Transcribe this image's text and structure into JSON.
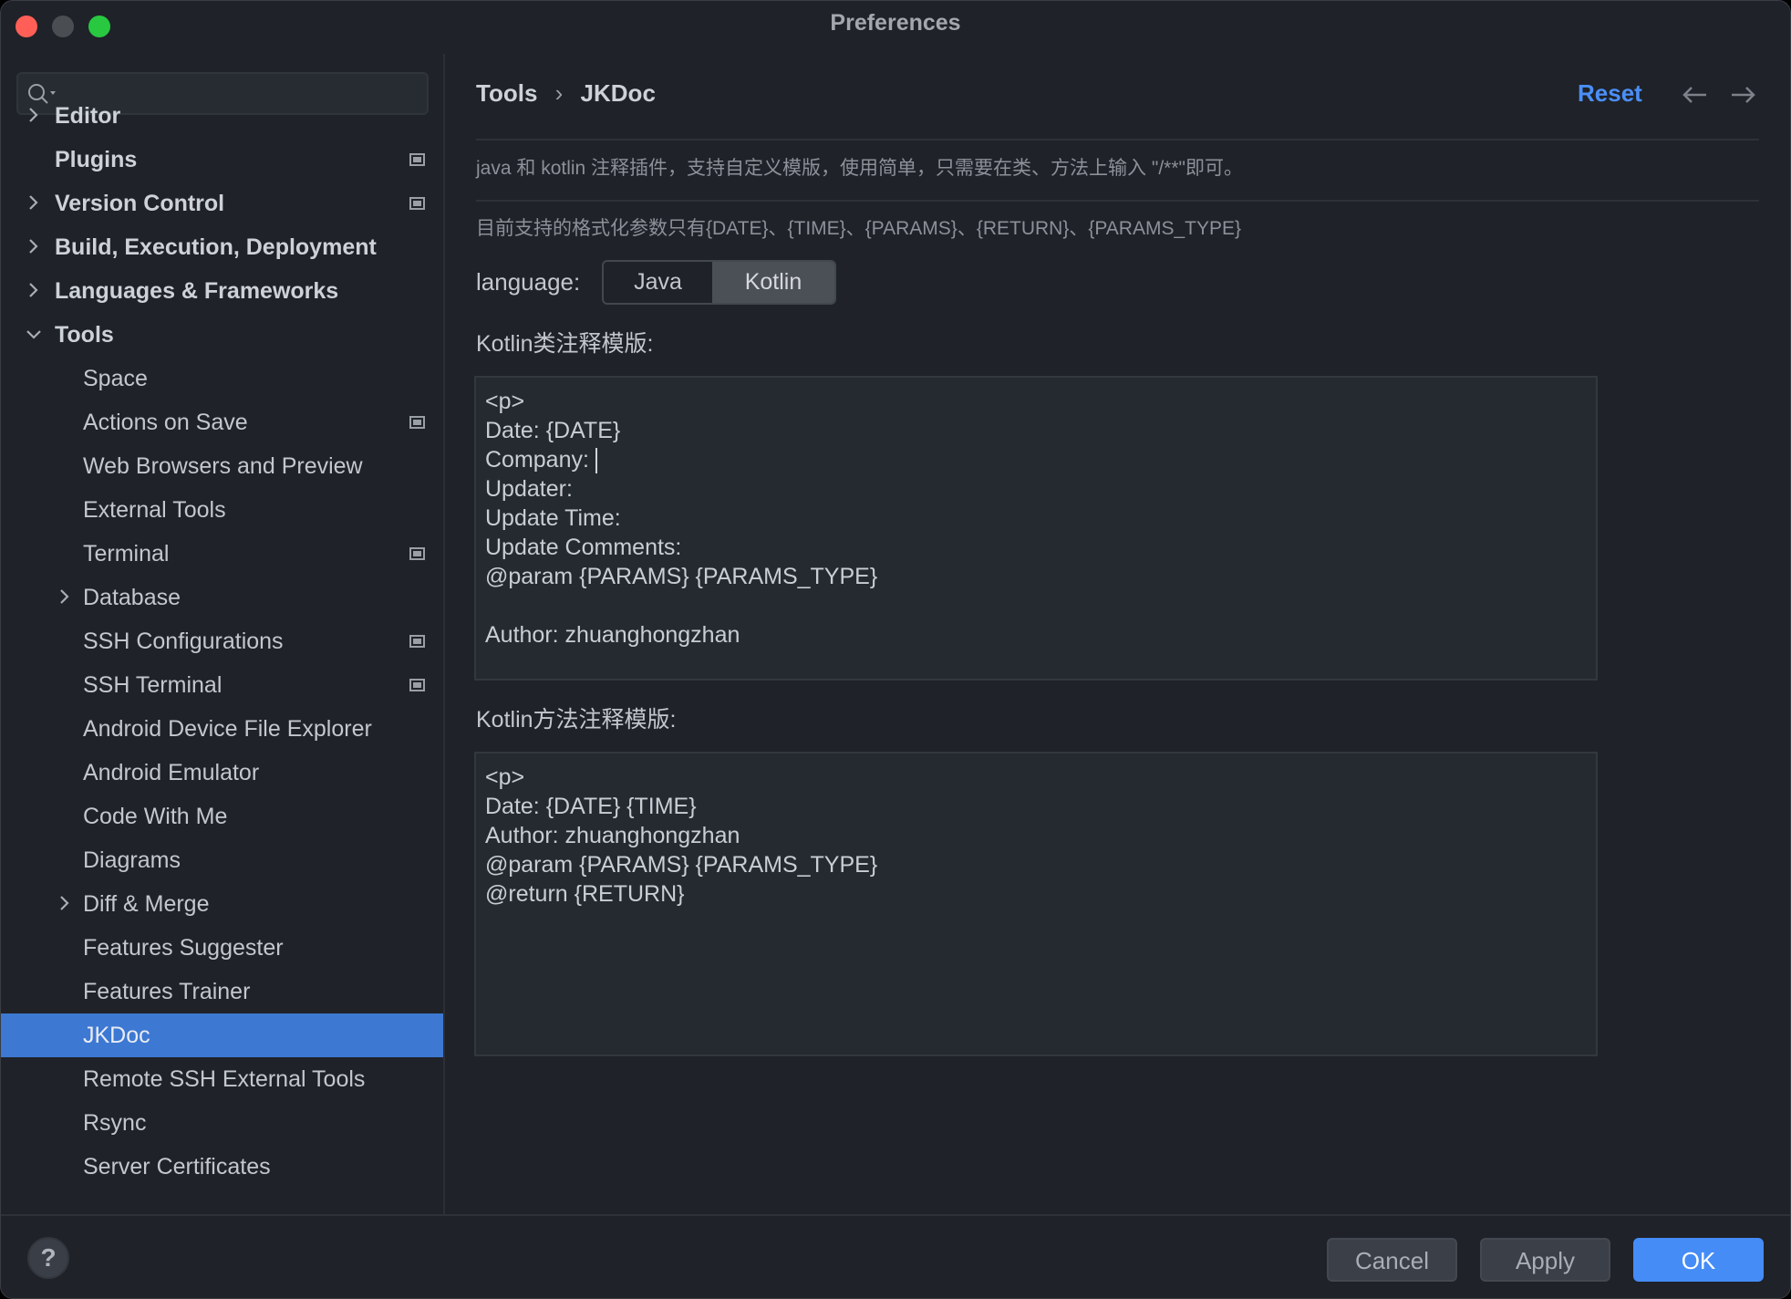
{
  "window": {
    "title": "Preferences"
  },
  "sidebar": {
    "search_placeholder": "",
    "items": [
      {
        "label": "Editor",
        "level": 0,
        "chevron": "right",
        "icon": false
      },
      {
        "label": "Plugins",
        "level": 0,
        "chevron": "",
        "icon": true
      },
      {
        "label": "Version Control",
        "level": 0,
        "chevron": "right",
        "icon": true
      },
      {
        "label": "Build, Execution, Deployment",
        "level": 0,
        "chevron": "right",
        "icon": false
      },
      {
        "label": "Languages & Frameworks",
        "level": 0,
        "chevron": "right",
        "icon": false
      },
      {
        "label": "Tools",
        "level": 0,
        "chevron": "down",
        "icon": false
      },
      {
        "label": "Space",
        "level": 1,
        "chevron": "",
        "icon": false
      },
      {
        "label": "Actions on Save",
        "level": 1,
        "chevron": "",
        "icon": true
      },
      {
        "label": "Web Browsers and Preview",
        "level": 1,
        "chevron": "",
        "icon": false
      },
      {
        "label": "External Tools",
        "level": 1,
        "chevron": "",
        "icon": false
      },
      {
        "label": "Terminal",
        "level": 1,
        "chevron": "",
        "icon": true
      },
      {
        "label": "Database",
        "level": 1,
        "chevron": "right",
        "icon": false
      },
      {
        "label": "SSH Configurations",
        "level": 1,
        "chevron": "",
        "icon": true
      },
      {
        "label": "SSH Terminal",
        "level": 1,
        "chevron": "",
        "icon": true
      },
      {
        "label": "Android Device File Explorer",
        "level": 1,
        "chevron": "",
        "icon": false
      },
      {
        "label": "Android Emulator",
        "level": 1,
        "chevron": "",
        "icon": false
      },
      {
        "label": "Code With Me",
        "level": 1,
        "chevron": "",
        "icon": false
      },
      {
        "label": "Diagrams",
        "level": 1,
        "chevron": "",
        "icon": false
      },
      {
        "label": "Diff & Merge",
        "level": 1,
        "chevron": "right",
        "icon": false
      },
      {
        "label": "Features Suggester",
        "level": 1,
        "chevron": "",
        "icon": false
      },
      {
        "label": "Features Trainer",
        "level": 1,
        "chevron": "",
        "icon": false
      },
      {
        "label": "JKDoc",
        "level": 1,
        "chevron": "",
        "icon": false,
        "selected": true
      },
      {
        "label": "Remote SSH External Tools",
        "level": 1,
        "chevron": "",
        "icon": false
      },
      {
        "label": "Rsync",
        "level": 1,
        "chevron": "",
        "icon": false
      },
      {
        "label": "Server Certificates",
        "level": 1,
        "chevron": "",
        "icon": false
      }
    ]
  },
  "header": {
    "breadcrumb": [
      "Tools",
      "JKDoc"
    ],
    "separator": "›",
    "reset": "Reset",
    "back_icon": "arrow-left",
    "forward_icon": "arrow-right"
  },
  "main": {
    "description": "java 和 kotlin 注释插件，支持自定义模版，使用简单，只需要在类、方法上输入 \"/**\"即可。",
    "params_note": "目前支持的格式化参数只有{DATE}、{TIME}、{PARAMS}、{RETURN}、{PARAMS_TYPE}",
    "language_label": "language:",
    "language_options": [
      "Java",
      "Kotlin"
    ],
    "language_selected": "Kotlin",
    "class_template_label": "Kotlin类注释模版:",
    "class_template_before_cursor": "<p>\nDate: {DATE}\nCompany: ",
    "class_template_after_cursor": "\nUpdater:\nUpdate Time:\nUpdate Comments:\n@param {PARAMS} {PARAMS_TYPE}\n\nAuthor: zhuanghongzhan",
    "method_template_label": "Kotlin方法注释模版:",
    "method_template": "<p>\nDate: {DATE} {TIME}\nAuthor: zhuanghongzhan\n@param {PARAMS} {PARAMS_TYPE}\n@return {RETURN}"
  },
  "footer": {
    "help": "?",
    "cancel": "Cancel",
    "apply": "Apply",
    "ok": "OK"
  },
  "colors": {
    "accent": "#4a8ff8",
    "selection": "#3d78d3",
    "ok_button": "#458cf7",
    "close": "#ff5f57",
    "minimize": "#4a4d52",
    "zoom": "#28c840"
  }
}
